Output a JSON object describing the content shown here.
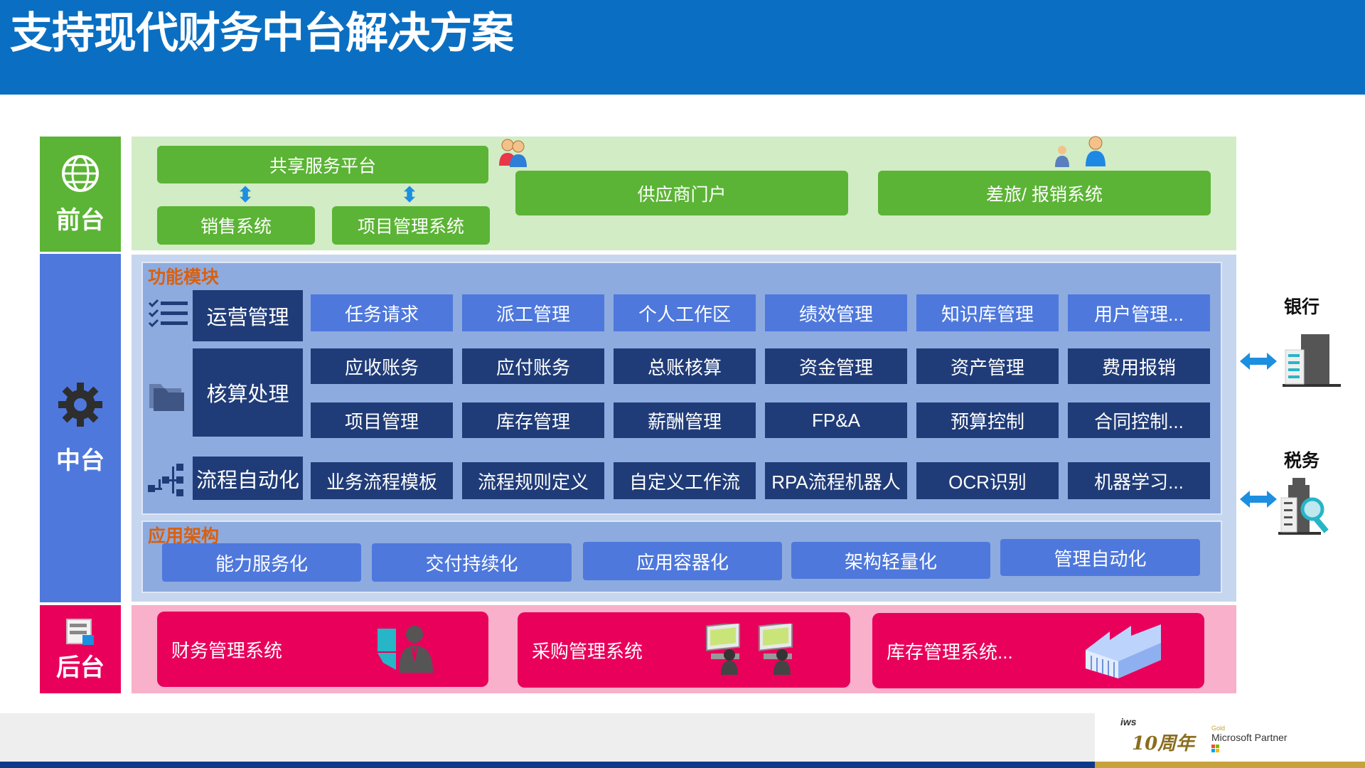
{
  "title": "支持现代财务中台解决方案",
  "colors": {
    "header_blue": "#0a6fc2",
    "front_green": "#5bb435",
    "front_bg": "#d2ecc6",
    "mid_blue": "#4e78dc",
    "mid_dark": "#203c78",
    "back_pink": "#e9005b",
    "back_bg": "#f9b0ca",
    "section_orange": "#d9600f"
  },
  "side": {
    "front": "前台",
    "middle": "中台",
    "back": "后台"
  },
  "front": {
    "shared_platform": "共享服务平台",
    "sales": "销售系统",
    "project": "项目管理系统",
    "supplier": "供应商门户",
    "travel": "差旅/ 报销系统"
  },
  "middle": {
    "function_label": "功能模块",
    "categories": {
      "ops": "运营管理",
      "accounting": "核算处理",
      "automation": "流程自动化"
    },
    "ops_row": [
      "任务请求",
      "派工管理",
      "个人工作区",
      "绩效管理",
      "知识库管理",
      "用户管理..."
    ],
    "acct_row1": [
      "应收账务",
      "应付账务",
      "总账核算",
      "资金管理",
      "资产管理",
      "费用报销"
    ],
    "acct_row2": [
      "项目管理",
      "库存管理",
      "薪酬管理",
      "FP&A",
      "预算控制",
      "合同控制..."
    ],
    "auto_row": [
      "业务流程模板",
      "流程规则定义",
      "自定义工作流",
      "RPA流程机器人",
      "OCR识别",
      "机器学习..."
    ],
    "arch_label": "应用架构",
    "arch": [
      "能力服务化",
      "交付持续化",
      "应用容器化",
      "架构轻量化",
      "管理自动化"
    ]
  },
  "back": {
    "finance": "财务管理系统",
    "purchase": "采购管理系统",
    "inventory": "库存管理系统..."
  },
  "external": {
    "bank": "银行",
    "tax": "税务"
  },
  "footer": {
    "partner_brand": "iws",
    "partner_anniversary": "10周年",
    "partner_text": "Microsoft Partner",
    "partner_small": "Gold"
  }
}
